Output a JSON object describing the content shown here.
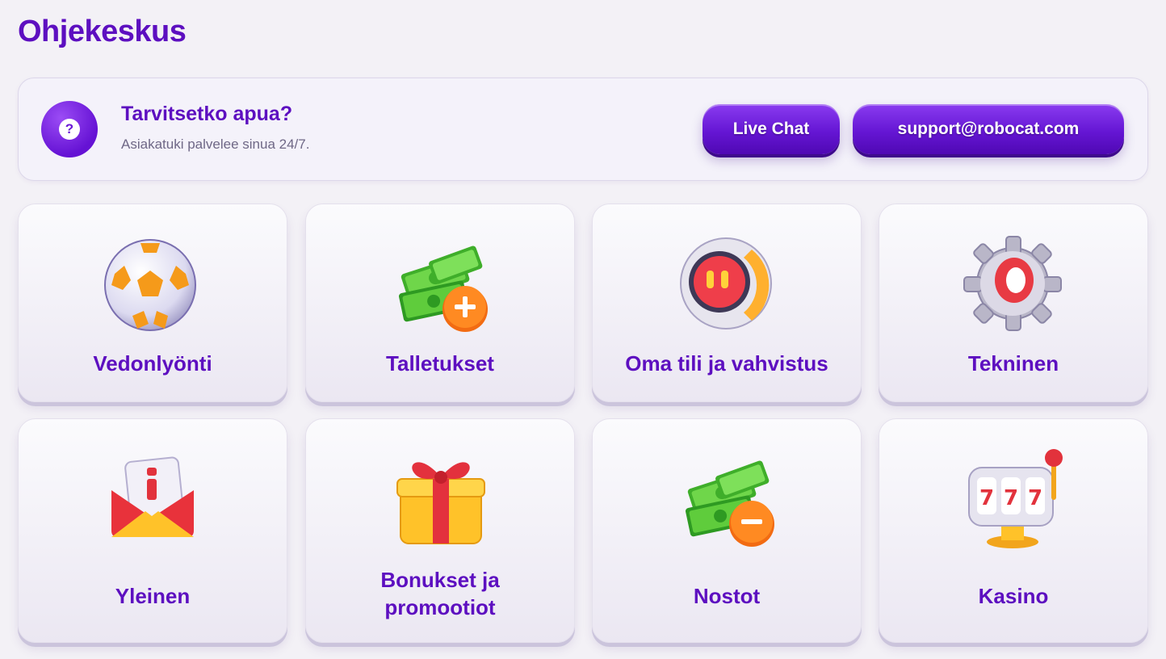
{
  "page": {
    "title": "Ohjekeskus"
  },
  "help": {
    "icon": "question-icon",
    "icon_glyph": "?",
    "title": "Tarvitsetko apua?",
    "subtitle": "Asiakatuki palvelee sinua 24/7.",
    "live_chat_label": "Live Chat",
    "email_label": "support@robocat.com"
  },
  "categories": [
    {
      "label": "Vedonlyönti",
      "icon": "soccer-ball-icon"
    },
    {
      "label": "Talletukset",
      "icon": "cash-deposit-icon"
    },
    {
      "label": "Oma tili ja vahvistus",
      "icon": "robot-head-icon"
    },
    {
      "label": "Tekninen",
      "icon": "gear-icon"
    },
    {
      "label": "Yleinen",
      "icon": "info-envelope-icon"
    },
    {
      "label": "Bonukset ja promootiot",
      "icon": "gift-box-icon"
    },
    {
      "label": "Nostot",
      "icon": "cash-withdraw-icon"
    },
    {
      "label": "Kasino",
      "icon": "slot-machine-icon"
    }
  ],
  "colors": {
    "brand": "#5d0fc0",
    "button": "#6516d4",
    "background": "#f3f1f6"
  }
}
